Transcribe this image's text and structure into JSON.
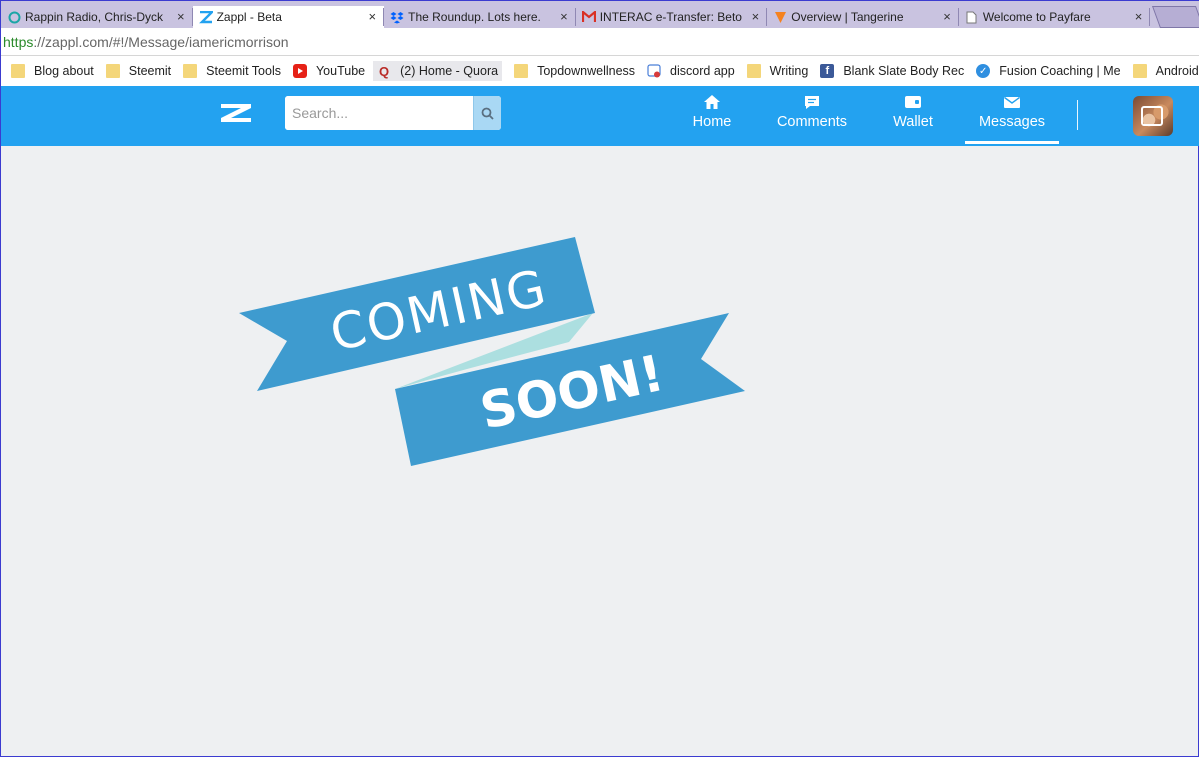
{
  "browser": {
    "tabs": [
      {
        "title": "Rappin Radio, Chris-Dyck",
        "icon": "circle-arrow-icon",
        "color": "#1aa6a6",
        "active": false
      },
      {
        "title": "Zappl - Beta",
        "icon": "zappl-icon",
        "color": "#23a2f0",
        "active": true
      },
      {
        "title": "The Roundup. Lots here.",
        "icon": "dropbox-icon",
        "color": "#0061fe",
        "active": false
      },
      {
        "title": "INTERAC e-Transfer: Beto",
        "icon": "gmail-icon",
        "color": "#d93025",
        "active": false
      },
      {
        "title": "Overview | Tangerine",
        "icon": "tangerine-icon",
        "color": "#f58220",
        "active": false
      },
      {
        "title": "Welcome to Payfare",
        "icon": "page-icon",
        "color": "#777777",
        "active": false
      }
    ],
    "close_glyph": "×",
    "address": {
      "scheme": "https",
      "rest": "://zappl.com/#!/Message/iamericmorrison"
    },
    "bookmarks": [
      {
        "label": "Blog about",
        "icon": "folder-icon"
      },
      {
        "label": "Steemit",
        "icon": "folder-icon"
      },
      {
        "label": "Steemit Tools",
        "icon": "folder-icon"
      },
      {
        "label": "YouTube",
        "icon": "youtube-icon"
      },
      {
        "label": "(2) Home - Quora",
        "icon": "quora-icon"
      },
      {
        "label": "Topdownwellness",
        "icon": "folder-icon"
      },
      {
        "label": "discord app",
        "icon": "discord-icon"
      },
      {
        "label": "Writing",
        "icon": "folder-icon"
      },
      {
        "label": "Blank Slate Body Rec",
        "icon": "facebook-icon"
      },
      {
        "label": "Fusion Coaching | Me",
        "icon": "check-icon"
      },
      {
        "label": "Android",
        "icon": "folder-icon"
      }
    ]
  },
  "app": {
    "search": {
      "placeholder": "Search..."
    },
    "nav": [
      {
        "label": "Home",
        "icon": "home-icon",
        "active": false
      },
      {
        "label": "Comments",
        "icon": "comment-icon",
        "active": false
      },
      {
        "label": "Wallet",
        "icon": "wallet-icon",
        "active": false
      },
      {
        "label": "Messages",
        "icon": "envelope-icon",
        "active": true
      }
    ],
    "brand_color": "#23a2f0"
  },
  "content": {
    "banner": {
      "line1": "COMING",
      "line2": "SOON!",
      "ribbon_color": "#3e9bcf",
      "fold_color": "#acdfe0"
    }
  }
}
